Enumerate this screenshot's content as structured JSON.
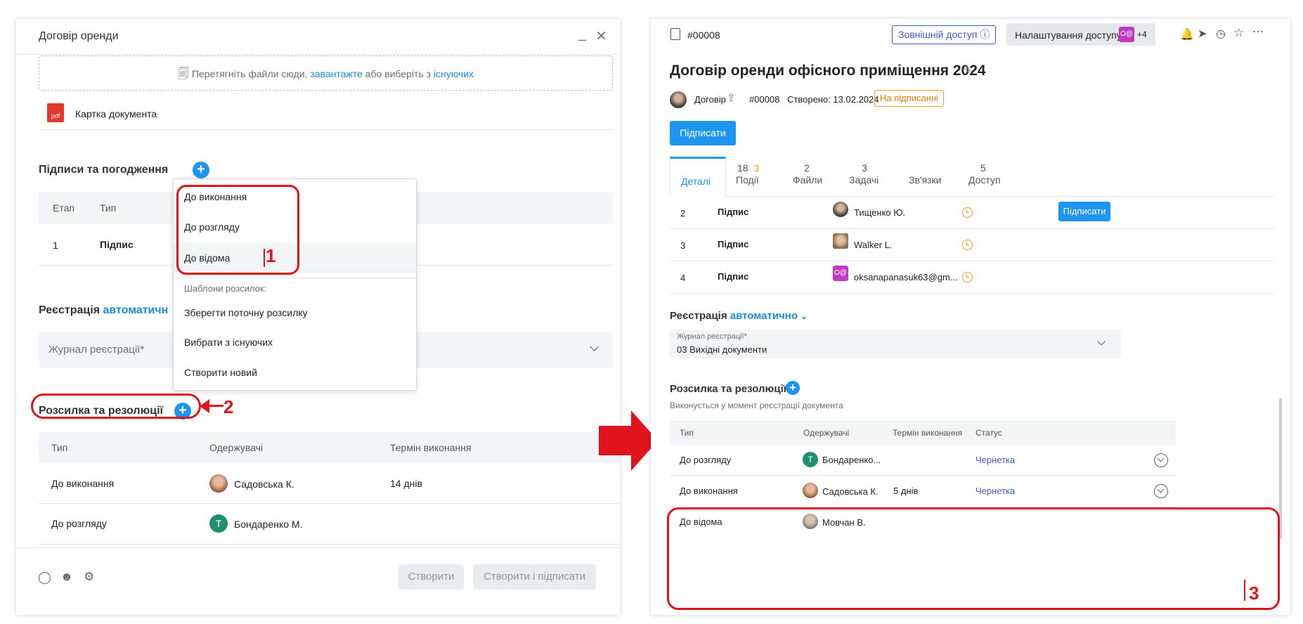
{
  "left": {
    "title": "Договір оренди",
    "upload": {
      "prefix": "Перетягніть файли сюди, ",
      "link1": "завантажте",
      "mid": " або виберіть з ",
      "link2": "існуючих"
    },
    "file_name": "Картка документа",
    "file_icon": "pdf",
    "signatures": {
      "title": "Підписи та погодження",
      "col_stage": "Етап",
      "col_type": "Тип",
      "row_stage": "1",
      "row_type": "Підпис"
    },
    "dropdown": {
      "items": [
        "До виконання",
        "До розгляду",
        "До відома"
      ],
      "section": "Шаблони розсилок:",
      "templates": [
        "Зберегти поточну розсилку",
        "Вибрати з існуючих",
        "Створити новий"
      ]
    },
    "registration": {
      "label": "Реєстрація",
      "mode": "автоматичн",
      "journal_placeholder": "Журнал реєстрації*"
    },
    "distribution": {
      "title": "Розсилка та резолюції",
      "columns": [
        "Тип",
        "Одержувачі",
        "Термін виконання"
      ],
      "rows": [
        {
          "type": "До виконання",
          "recipient": "Садовська К.",
          "term": "14 днів"
        },
        {
          "type": "До розгляду",
          "recipient": "Бондаренко М.",
          "term": "",
          "initial": "Т"
        }
      ]
    },
    "footer": {
      "create": "Створити",
      "create_sign": "Створити і підписати"
    }
  },
  "annotations": {
    "n1": "1",
    "n2": "2",
    "n3": "3"
  },
  "right": {
    "doc_id": "#00008",
    "external_access": "Зовнішній доступ",
    "access_settings": "Налаштування доступу",
    "access_badge": "O@",
    "access_more": "+4",
    "title": "Договір оренди офісного приміщення 2024",
    "meta": {
      "type": "Договір",
      "number": "#00008",
      "created": "Створено: 13.02.2024",
      "status": "На підписанні"
    },
    "sign_button": "Підписати",
    "tabs": [
      {
        "count": "",
        "extra": "",
        "label": "Деталі"
      },
      {
        "count": "18",
        "extra": "3",
        "label": "Події"
      },
      {
        "count": "2",
        "extra": "",
        "label": "Файли"
      },
      {
        "count": "3",
        "extra": "",
        "label": "Задачі"
      },
      {
        "count": "",
        "extra": "",
        "label": "Зв'язки"
      },
      {
        "count": "5",
        "extra": "",
        "label": "Доступ"
      }
    ],
    "sign_rows": [
      {
        "n": "2",
        "type": "Підпис",
        "name": "Тищенко Ю.",
        "action": "Підписати"
      },
      {
        "n": "3",
        "type": "Підпис",
        "name": "Walker L.",
        "action": ""
      },
      {
        "n": "4",
        "type": "Підпис",
        "name": "oksanapanasuk63@gm...",
        "action": "",
        "badge": "O@"
      }
    ],
    "registration": {
      "label": "Реєстрація",
      "mode": "автоматично",
      "journal_label": "Журнал реєстрації*",
      "journal_value": "03 Вихідні документи"
    },
    "distribution": {
      "title": "Розсилка та резолюції",
      "subtitle": "Виконується у момент реєстрації документа",
      "columns": [
        "Тип",
        "Одержувачі",
        "Термін виконання",
        "Статус"
      ],
      "rows": [
        {
          "type": "До розгляду",
          "recipient": "Бондаренко...",
          "term": "",
          "status": "Чернетка",
          "initial": "Т"
        },
        {
          "type": "До виконання",
          "recipient": "Садовська К.",
          "term": "5 днів",
          "status": "Чернетка"
        },
        {
          "type": "До відома",
          "recipient": "Мовчан В.",
          "term": "",
          "status": ""
        }
      ]
    }
  },
  "colors": {
    "accent": "#1e96f0",
    "annotation_red": "#e0141c",
    "status_orange": "#f59a23"
  }
}
